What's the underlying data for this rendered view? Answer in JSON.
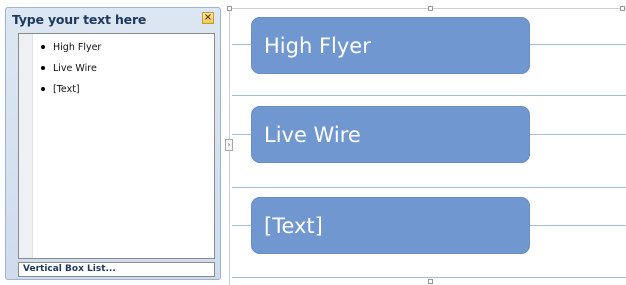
{
  "text_pane": {
    "title": "Type your text here",
    "close_glyph": "×",
    "items": [
      {
        "label": "High Flyer"
      },
      {
        "label": "Live Wire"
      },
      {
        "label": "[Text]"
      }
    ],
    "footer_label": "Vertical Box List..."
  },
  "diagram": {
    "boxes": [
      {
        "label": "High Flyer"
      },
      {
        "label": "Live Wire"
      },
      {
        "label": "[Text]"
      }
    ],
    "box_color": "#7197d0",
    "line_color": "#a3bdd8"
  },
  "expand_glyph": "›"
}
